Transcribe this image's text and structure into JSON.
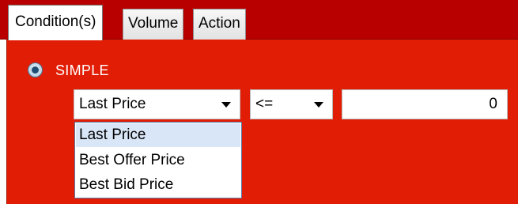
{
  "tabs": [
    {
      "label": "Condition(s)",
      "active": true
    },
    {
      "label": "Volume",
      "active": false
    },
    {
      "label": "Action",
      "active": false
    }
  ],
  "condition": {
    "mode_label": "SIMPLE",
    "mode_selected": true,
    "field_select": {
      "value": "Last Price",
      "options": [
        "Last Price",
        "Best Offer Price",
        "Best Bid Price"
      ],
      "highlighted": "Last Price"
    },
    "operator_select": {
      "value": "<="
    },
    "threshold_input": {
      "value": "0"
    }
  },
  "colors": {
    "tabstrip": "#b80000",
    "panel": "#e21d05",
    "highlight": "#d9e6f7"
  },
  "icons": {
    "radio": "radio-selected-icon",
    "dropdown": "chevron-down-icon"
  }
}
